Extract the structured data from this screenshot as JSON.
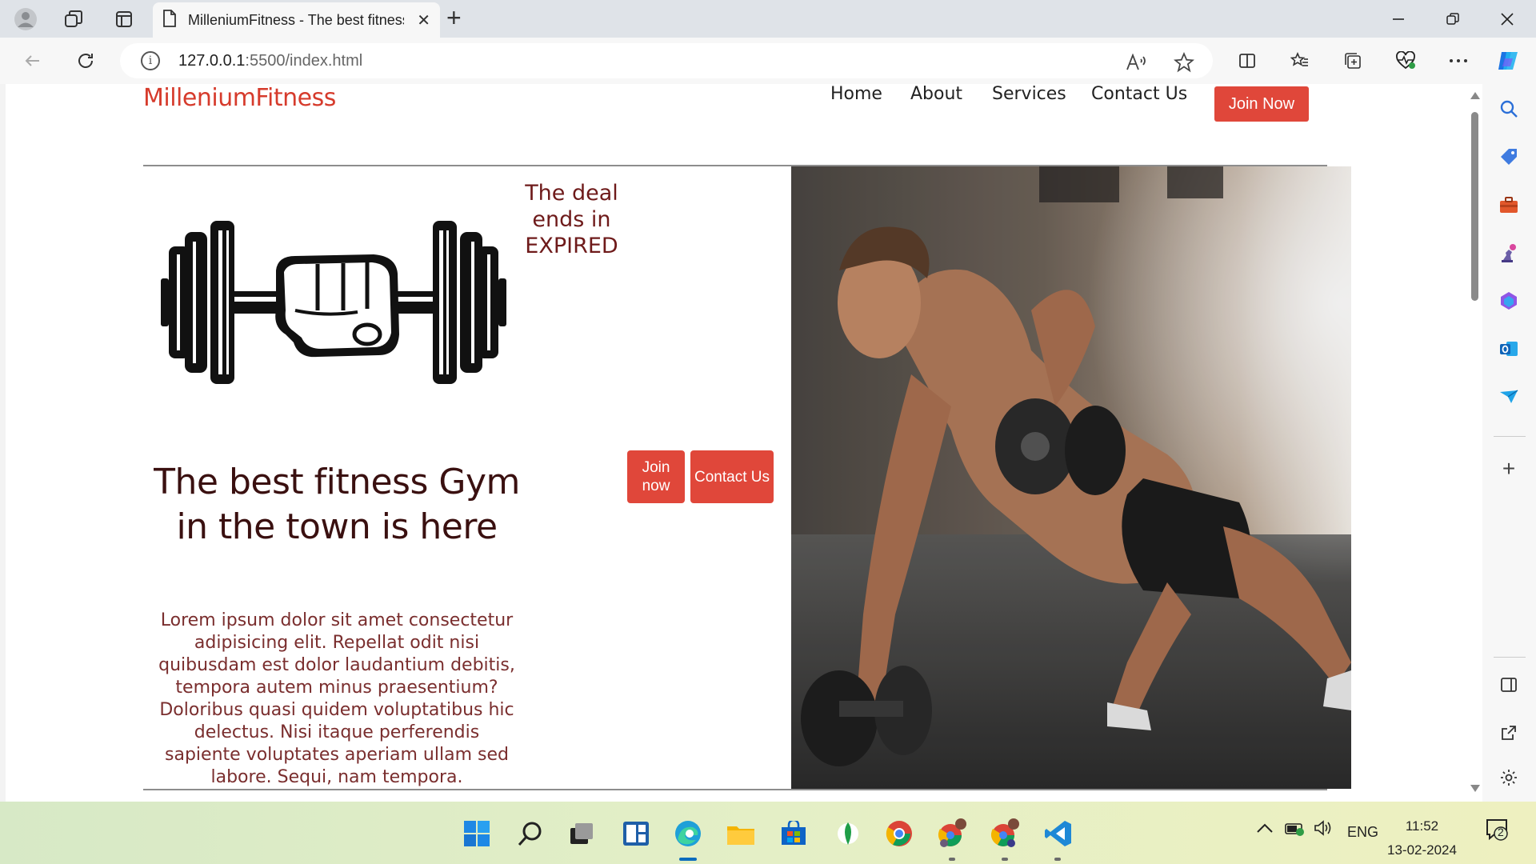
{
  "browser": {
    "tab_title": "MilleniumFitness - The best fitness Gym in the town",
    "url_host": "127.0.0.1",
    "url_path": ":5500/index.html",
    "window_controls": [
      "minimize-icon",
      "restore-icon",
      "close-icon"
    ]
  },
  "site": {
    "brand": "MilleniumFitness",
    "nav": [
      "Home",
      "About",
      "Services",
      "Contact Us"
    ],
    "join_top": "Join Now",
    "deal_text": "The deal ends in EXPIRED",
    "hero_buttons": {
      "join": "Join now",
      "contact": "Contact Us"
    },
    "headline": "The best fitness Gym in the town is here",
    "body": "Lorem ipsum dolor sit amet consectetur adipisicing elit. Repellat odit nisi quibusdam est dolor laudantium debitis, tempora autem minus praesentium? Doloribus quasi quidem voluptatibus hic delectus. Nisi itaque perferendis sapiente voluptates aperiam ullam sed labore. Sequi, nam tempora.",
    "colors": {
      "brand": "#d63b2c",
      "button": "#e0473a",
      "headline": "#3a1010",
      "body": "#7a2e2e"
    }
  },
  "taskbar": {
    "language": "ENG",
    "time": "11:52",
    "date": "13-02-2024",
    "notification_count": "2",
    "apps": [
      "windows-start-icon",
      "search-icon",
      "task-view-icon",
      "widgets-icon",
      "edge-icon",
      "file-explorer-icon",
      "microsoft-store-icon",
      "mongodb-compass-icon",
      "chrome-icon",
      "chrome-profile-icon",
      "chrome-profile-2-icon",
      "vscode-icon"
    ]
  }
}
